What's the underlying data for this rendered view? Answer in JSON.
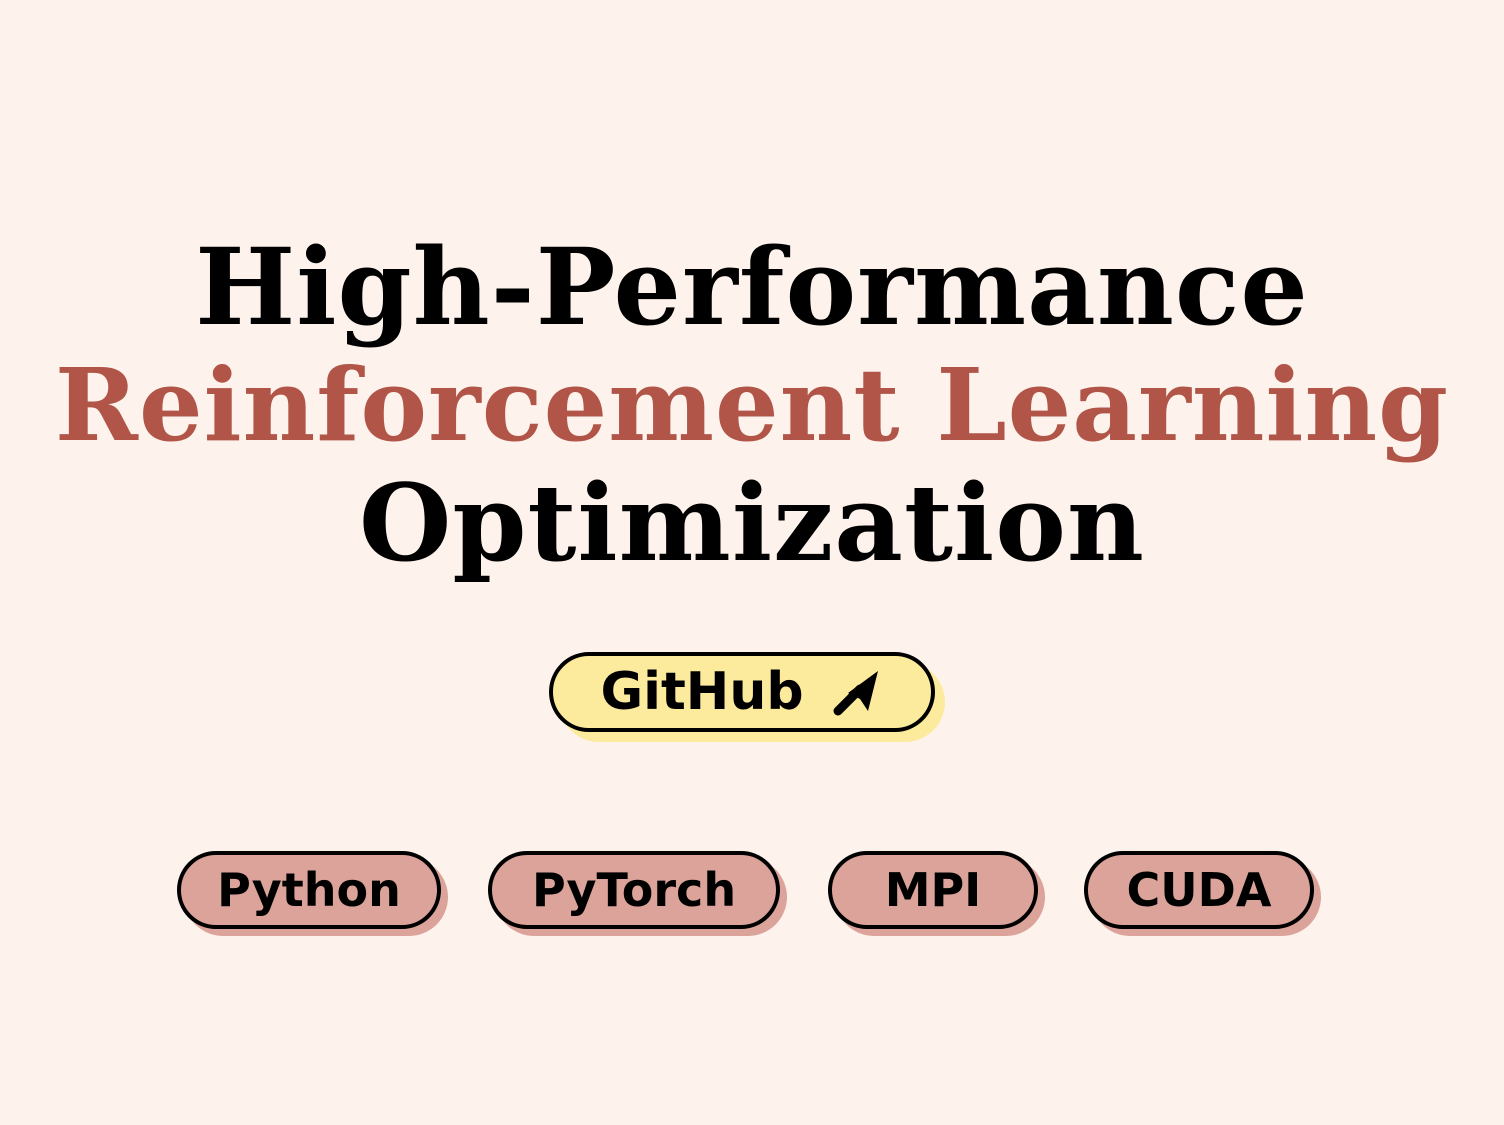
{
  "title": {
    "line1": "High-Performance",
    "line2": "Reinforcement Learning",
    "line3": "Optimization"
  },
  "github_button": {
    "label": "GitHub",
    "icon": "arrow-up-right-icon"
  },
  "tags": [
    "Python",
    "PyTorch",
    "MPI",
    "CUDA"
  ],
  "colors": {
    "background": "#fdf3ec",
    "accent": "#b05547",
    "button_fill": "#fdeb9d",
    "tag_fill": "#dba39a",
    "outline": "#000000"
  }
}
